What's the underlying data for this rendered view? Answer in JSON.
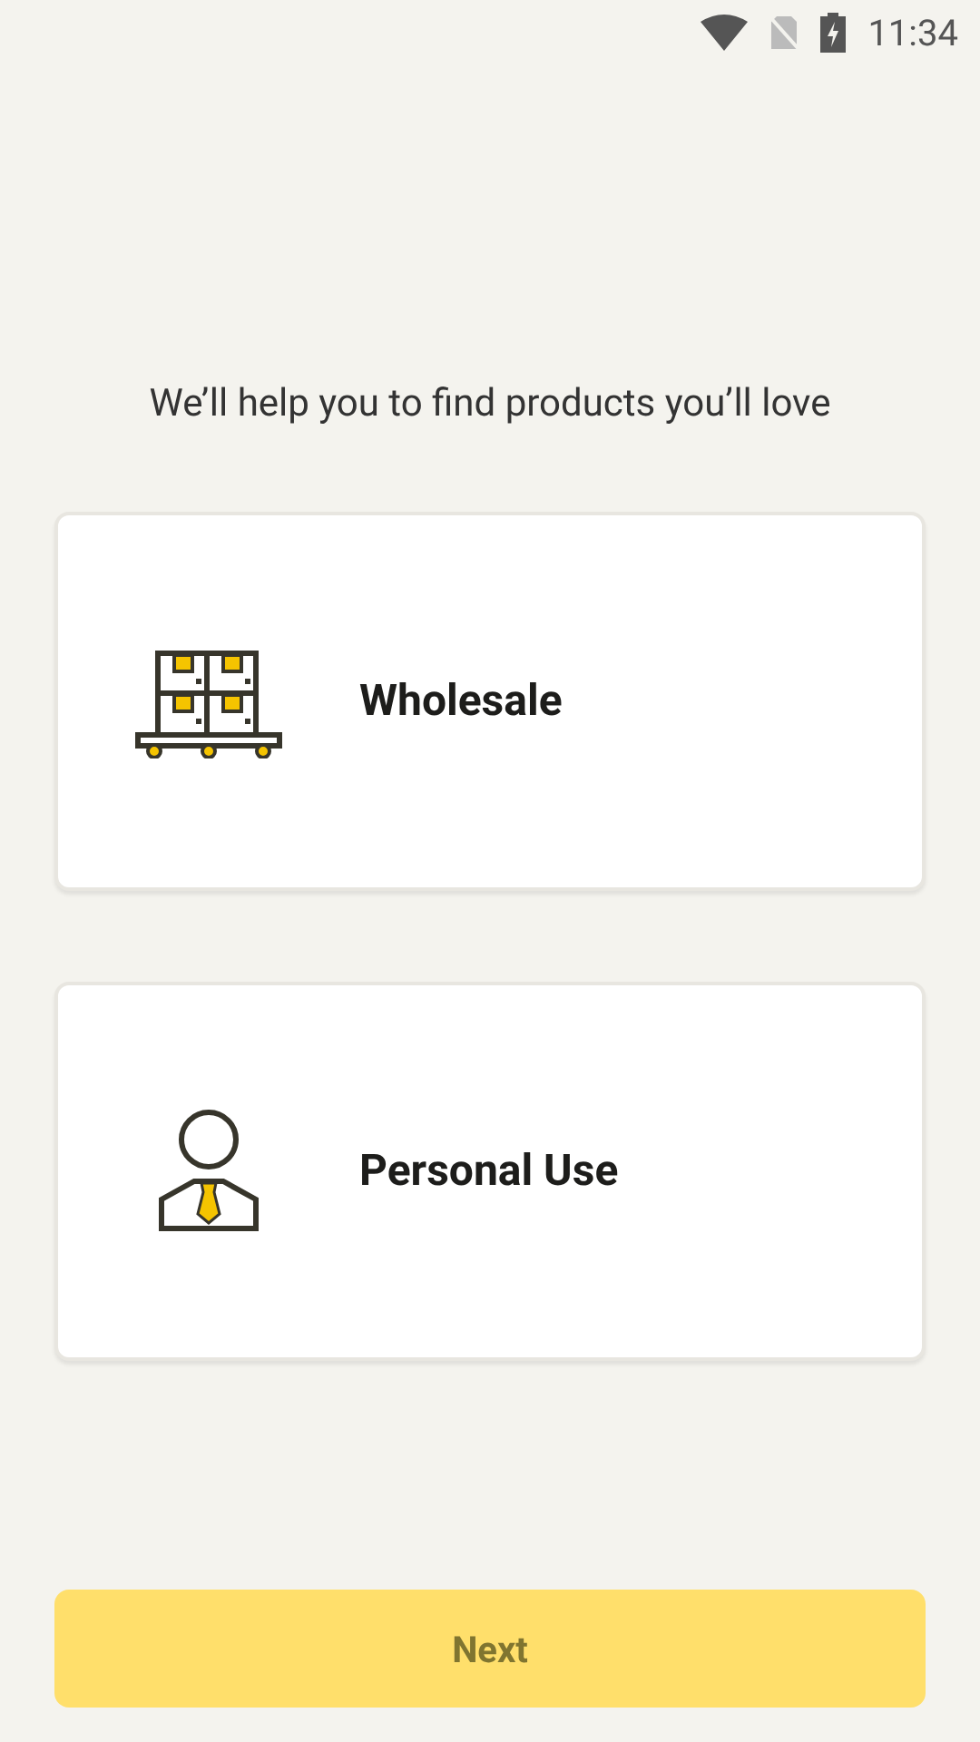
{
  "status_bar": {
    "time": "11:34"
  },
  "prompt": "We’ll help you to find products you’ll love",
  "options": [
    {
      "kind": "wholesale",
      "label": "Wholesale",
      "selected": false
    },
    {
      "kind": "personal",
      "label": "Personal Use",
      "selected": false
    }
  ],
  "next_button": {
    "label": "Next",
    "disabled": true
  }
}
